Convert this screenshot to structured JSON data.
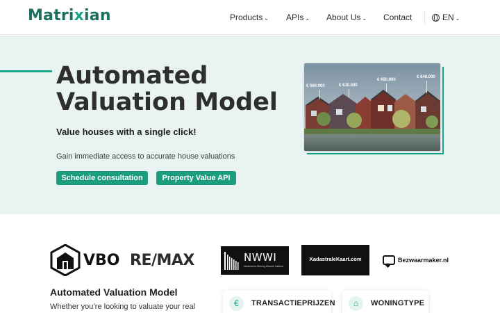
{
  "header": {
    "logo": {
      "part1": "Matri",
      "part2": "x",
      "part3": "ian"
    },
    "nav": [
      {
        "label": "Products",
        "chevron": "⌄"
      },
      {
        "label": "APIs",
        "chevron": "⌄"
      },
      {
        "label": "About Us",
        "chevron": "⌄"
      },
      {
        "label": "Contact"
      }
    ],
    "language": {
      "label": "EN",
      "chevron": "⌄",
      "icon": "globe-icon"
    }
  },
  "hero": {
    "title": "Automated Valuation Model",
    "subtitle": "Value houses with a single click!",
    "description": "Gain immediate access to accurate house valuations",
    "buttons": {
      "schedule": "Schedule consultation",
      "api": "Property Value API"
    },
    "photo_prices": [
      "€ 560.000",
      "€ 630.000",
      "€ 650.000",
      "€ 640.000"
    ]
  },
  "partners": {
    "vbo": "VBO",
    "remax": "RE/MAX",
    "nwwi": "NWWI",
    "nwwi_sub": "Nederlands Woning Waarde Instituut",
    "kadastrale": "KadastraleKaart.com",
    "bezwaarmaker": "Bezwaarmaker.nl"
  },
  "lower": {
    "title": "Automated Valuation Model",
    "description": "Whether you’re looking to valuate your real"
  },
  "cards": [
    {
      "label": "TRANSACTIEPRIJZEN",
      "icon": "euro-icon",
      "glyph": "€"
    },
    {
      "label": "WONINGTYPE",
      "icon": "house-icon",
      "glyph": "⌂"
    }
  ],
  "colors": {
    "brand": "#1f6f5f",
    "accent": "#19a389",
    "button": "#1b9e7d",
    "hero_bg": "#e8f3f2"
  }
}
